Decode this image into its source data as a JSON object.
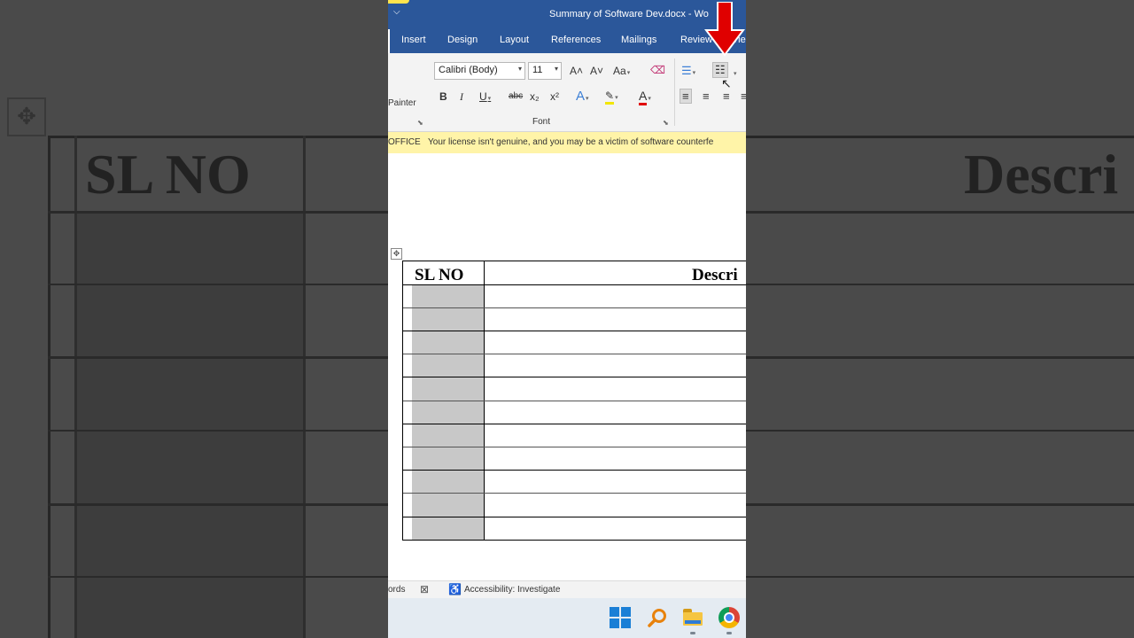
{
  "app": {
    "doc_title": "Summary of Software Dev.docx - Wo",
    "qat_glyph": "⌵"
  },
  "tabs": [
    {
      "label": "Insert"
    },
    {
      "label": "Design"
    },
    {
      "label": "Layout"
    },
    {
      "label": "References"
    },
    {
      "label": "Mailings"
    },
    {
      "label": "Review"
    },
    {
      "label": "Vie"
    }
  ],
  "ribbon": {
    "painter_label": "Painter",
    "font_name": "Calibri (Body)",
    "font_size": "11",
    "grow_font": "A˄",
    "shrink_font": "A˅",
    "change_case": "Aa",
    "bold": "B",
    "italic": "I",
    "underline": "U",
    "strikethrough": "abc",
    "subscript": "x₂",
    "superscript": "x²",
    "text_effects": "A",
    "font_color": "A",
    "font_group_label": "Font"
  },
  "warning": {
    "label": "OFFICE",
    "message": "Your license isn't genuine, and you may be a victim of software counterfe"
  },
  "table": {
    "headers": [
      "SL NO",
      "Descri"
    ]
  },
  "status": {
    "words": "ords",
    "accessibility": "Accessibility: Investigate"
  },
  "colors": {
    "title_bar": "#2b579a",
    "warning_bg": "#fff4a8",
    "highlight_arrow": "#e00000"
  }
}
